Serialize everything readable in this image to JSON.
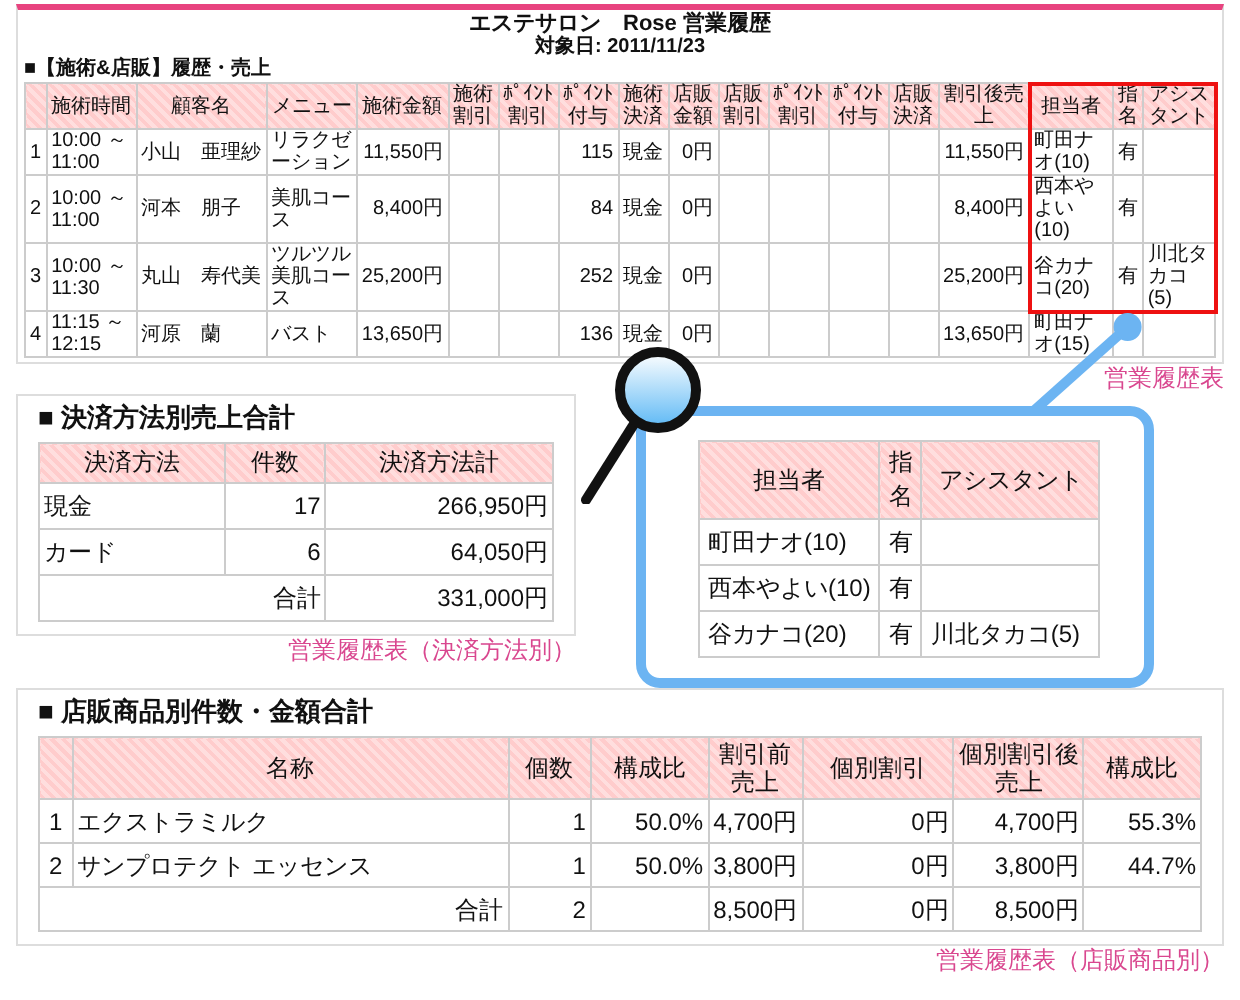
{
  "history_report": {
    "title": "エステサロン　Rose 営業履歴",
    "date": "対象日: 2011/11/23",
    "section": "■【施術&店販】履歴・売上",
    "columns": [
      {
        "label": "施術時間",
        "highlighted": false
      },
      {
        "label": "顧客名",
        "highlighted": false
      },
      {
        "label": "メニュー",
        "highlighted": false
      },
      {
        "label": "施術金額",
        "highlighted": false
      },
      {
        "label": "施術割引",
        "highlighted": false
      },
      {
        "label": "ﾎﾟｲﾝﾄ割引",
        "highlighted": false
      },
      {
        "label": "ﾎﾟｲﾝﾄ付与",
        "highlighted": false
      },
      {
        "label": "施術決済",
        "highlighted": false
      },
      {
        "label": "店販金額",
        "highlighted": false
      },
      {
        "label": "店販割引",
        "highlighted": false
      },
      {
        "label": "ﾎﾟｲﾝﾄ割引",
        "highlighted": false
      },
      {
        "label": "ﾎﾟｲﾝﾄ付与",
        "highlighted": false
      },
      {
        "label": "店販決済",
        "highlighted": false
      },
      {
        "label": "割引後売上",
        "highlighted": false
      },
      {
        "label": "担当者",
        "highlighted": true
      },
      {
        "label": "指名",
        "highlighted": true
      },
      {
        "label": "アシスタント",
        "highlighted": true
      }
    ],
    "rows": [
      {
        "no": "1",
        "highlighted": true,
        "time": "10:00 ～ 11:00",
        "customer": "小山　亜理紗",
        "menu": "リラクゼーション",
        "treatment_amount": "11,550円",
        "points_granted": "115",
        "treatment_payment": "現金",
        "retail_amount": "0円",
        "net_sales": "11,550円",
        "staff": "町田ナオ(10)",
        "nominated": "有"
      },
      {
        "no": "2",
        "highlighted": true,
        "time": "10:00 ～ 11:00",
        "customer": "河本　朋子",
        "menu": "美肌コース",
        "treatment_amount": "8,400円",
        "points_granted": "84",
        "treatment_payment": "現金",
        "retail_amount": "0円",
        "net_sales": "8,400円",
        "staff": "西本やよい(10)",
        "nominated": "有"
      },
      {
        "no": "3",
        "highlighted": true,
        "time": "10:00 ～ 11:30",
        "customer": "丸山　寿代美",
        "menu": "ツルツル美肌コース",
        "treatment_amount": "25,200円",
        "points_granted": "252",
        "treatment_payment": "現金",
        "retail_amount": "0円",
        "net_sales": "25,200円",
        "staff": "谷カナコ(20)",
        "nominated": "有",
        "assistant": "川北タカコ(5)"
      },
      {
        "no": "4",
        "highlighted": false,
        "time": "11:15 ～ 12:15",
        "customer": "河原　蘭",
        "menu": "バスト",
        "treatment_amount": "13,650円",
        "points_granted": "136",
        "treatment_payment": "現金",
        "retail_amount": "0円",
        "net_sales": "13,650円",
        "staff": "町田ナオ(15)"
      }
    ],
    "caption": "営業履歴表"
  },
  "payment_summary": {
    "title": "■ 決済方法別売上合計",
    "columns": [
      "決済方法",
      "件数",
      "決済方法計"
    ],
    "rows": [
      [
        "現金",
        "17",
        "266,950円"
      ],
      [
        "カード",
        "6",
        "64,050円"
      ]
    ],
    "total": {
      "label": "合計",
      "amount": "331,000円"
    },
    "caption": "営業履歴表（決済方法別）"
  },
  "zoom_callout": {
    "columns": [
      "担当者",
      "指名",
      "アシスタント"
    ],
    "rows": [
      {
        "staff": "町田ナオ(10)",
        "nominated": "有"
      },
      {
        "staff": "西本やよい(10)",
        "nominated": "有"
      },
      {
        "staff": "谷カナコ(20)",
        "nominated": "有",
        "assistant": "川北タカコ(5)"
      }
    ]
  },
  "product_summary": {
    "title": "■ 店販商品別件数・金額合計",
    "columns": [
      "名称",
      "個数",
      "構成比",
      "割引前売上",
      "個別割引",
      "個別割引後売上",
      "構成比"
    ],
    "rows": [
      {
        "no": "1",
        "cells": [
          "エクストラミルク",
          "1",
          "50.0%",
          "4,700円",
          "0円",
          "4,700円",
          "55.3%"
        ]
      },
      {
        "no": "2",
        "cells": [
          "サンプロテクト エッセンス",
          "1",
          "50.0%",
          "3,800円",
          "0円",
          "3,800円",
          "44.7%"
        ]
      }
    ],
    "total": {
      "label": "合計",
      "count": "2",
      "before_discount": "8,500円",
      "discount": "0円",
      "after_discount": "8,500円"
    },
    "caption": "営業履歴表（店販商品別）"
  }
}
